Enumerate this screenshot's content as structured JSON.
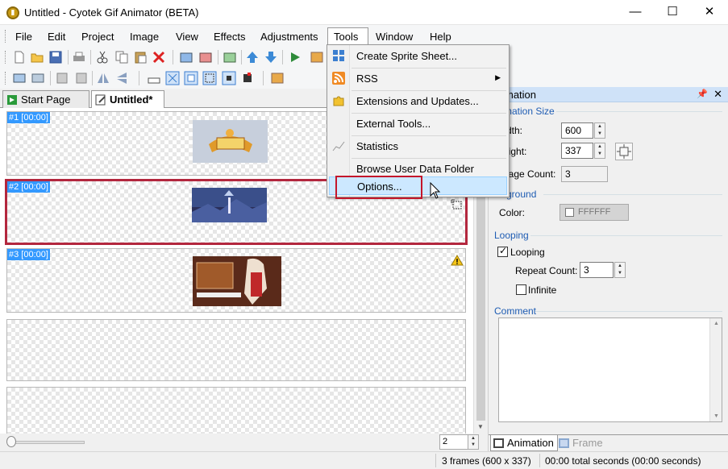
{
  "window": {
    "title": "Untitled - Cyotek Gif Animator (BETA)",
    "minimize": "—",
    "maximize": "☐",
    "close": "✕"
  },
  "menubar": {
    "items": [
      "File",
      "Edit",
      "Project",
      "Image",
      "View",
      "Effects",
      "Adjustments",
      "Tools",
      "Window",
      "Help"
    ]
  },
  "tabs": {
    "start_page": "Start Page",
    "untitled": "Untitled*"
  },
  "frames": [
    {
      "label": "#1 [00:00]"
    },
    {
      "label": "#2 [00:00]"
    },
    {
      "label": "#3 [00:00]"
    }
  ],
  "tools_menu": {
    "items": [
      {
        "label": "Create Sprite Sheet...",
        "icon": "sprite-sheet-icon"
      },
      {
        "label": "RSS",
        "icon": "rss-icon",
        "submenu": true
      },
      {
        "label": "Extensions and Updates...",
        "icon": "puzzle-icon"
      },
      {
        "label": "External Tools...",
        "icon": ""
      },
      {
        "label": "Statistics",
        "icon": "chart-icon"
      },
      {
        "label": "Browse User Data Folder",
        "icon": ""
      },
      {
        "label": "Options...",
        "icon": ""
      }
    ]
  },
  "panel": {
    "title": "Animation",
    "title_visible": "mation",
    "animation_size": {
      "group_title": "Animation Size",
      "group_title_visible": "mation Size",
      "width_label": "Width:",
      "width_label_visible": "dth:",
      "width_value": "600",
      "height_label": "Height:",
      "height_label_visible": "eight:",
      "height_value": "337",
      "image_count_label": "Image Count:",
      "image_count_label_visible": "nage Count:",
      "image_count_value": "3"
    },
    "background": {
      "group_title": "Background",
      "group_title_visible": "ckground",
      "color_label": "Color:",
      "color_value": "FFFFFF"
    },
    "looping": {
      "group_title": "Looping",
      "looping_label": "Looping",
      "looping_checked": true,
      "repeat_count_label": "Repeat Count:",
      "repeat_count_value": "3",
      "infinite_label": "Infinite",
      "infinite_checked": false
    },
    "comment": {
      "group_title": "Comment",
      "value": ""
    },
    "tabs": {
      "animation": "Animation",
      "frame": "Frame"
    }
  },
  "zoom_spin": "2",
  "statusbar": {
    "frames": "3 frames (600 x 337)",
    "total": "00:00 total seconds (00:00 seconds)"
  },
  "colors": {
    "selection_border": "#b3273e",
    "highlight_box": "#c4162a",
    "frame_label_bg": "#3399ff",
    "panel_header": "#cfe2f8",
    "menu_hover": "#cce8ff"
  }
}
